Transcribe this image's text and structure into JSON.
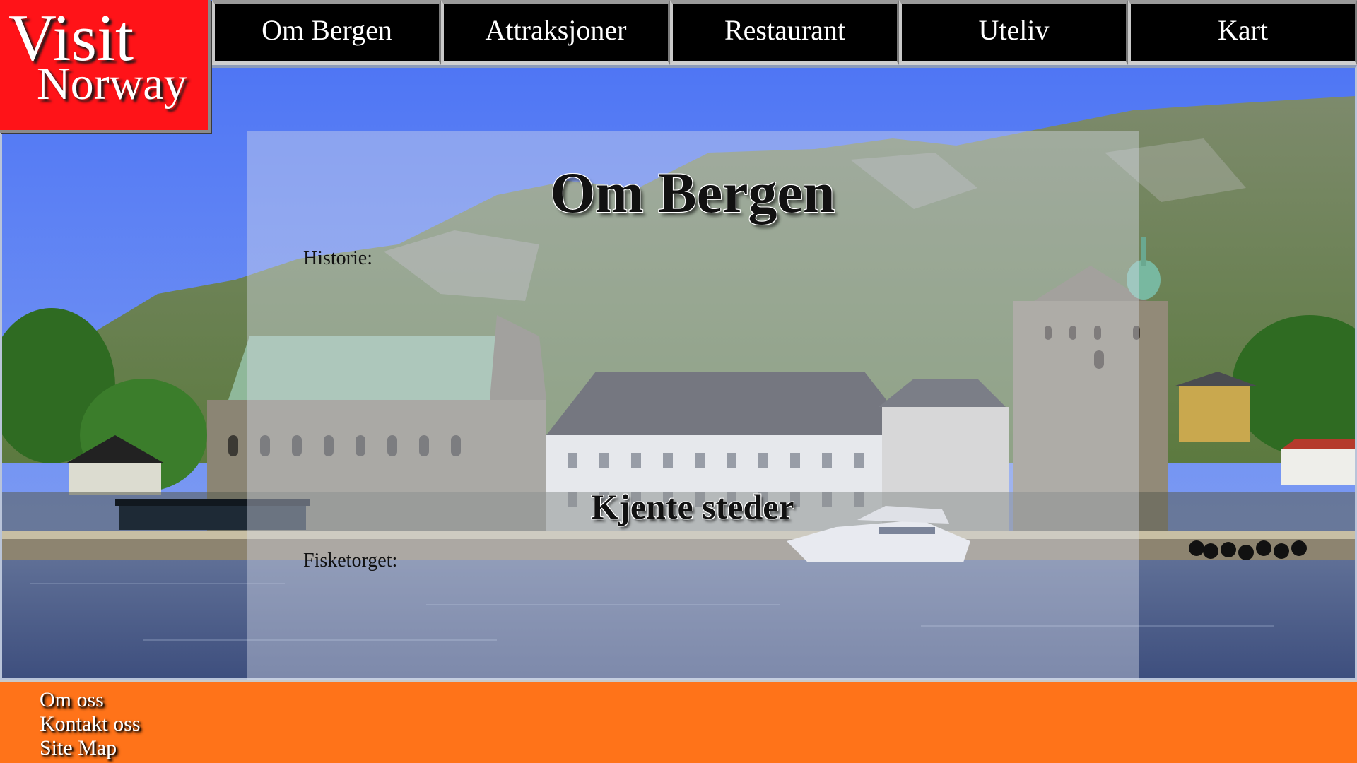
{
  "logo": {
    "line1": "Visit",
    "line2": "Norway"
  },
  "nav": {
    "items": [
      {
        "label": "Om Bergen"
      },
      {
        "label": "Attraksjoner"
      },
      {
        "label": "Restaurant"
      },
      {
        "label": "Uteliv"
      },
      {
        "label": "Kart"
      }
    ]
  },
  "main": {
    "title": "Om Bergen",
    "historie_label": "Historie:",
    "subtitle": "Kjente steder",
    "fisketorget_label": "Fisketorget:"
  },
  "footer": {
    "links": [
      {
        "label": "Om oss"
      },
      {
        "label": "Kontakt oss"
      },
      {
        "label": "Site Map"
      }
    ]
  },
  "colors": {
    "logo_bg": "#ff1318",
    "nav_bg": "#000000",
    "footer_bg": "#ff7319",
    "sky": "#5b7ff5"
  }
}
